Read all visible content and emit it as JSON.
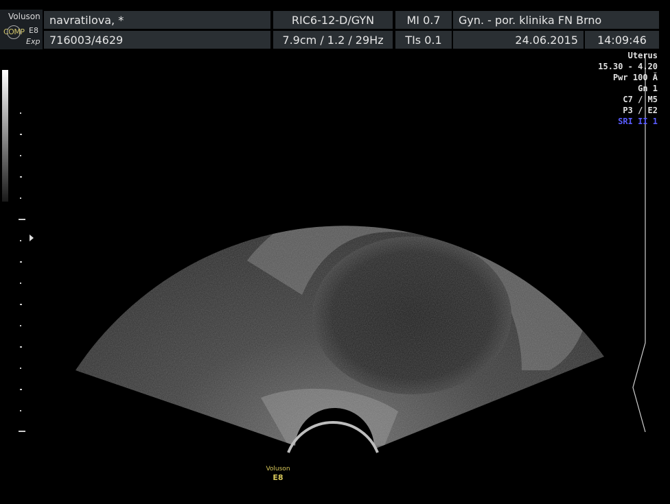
{
  "header": {
    "brand": "Voluson",
    "model": "E8",
    "comp_label": "COMP",
    "exp_label": "Exp",
    "patient_name": "navratilova,  *",
    "patient_id": "716003/4629",
    "probe": "RIC6-12-D/GYN",
    "depth_freq": "7.9cm / 1.2 / 29Hz",
    "mi": "MI  0.7",
    "tis": "TIs  0.1",
    "institution": "Gyn. - por. klinika FN Brno",
    "date": "24.06.2015",
    "time": "14:09:46"
  },
  "params": {
    "preset": "Uterus",
    "range": "15.30 - 4.20",
    "power": "Pwr 100 Ă",
    "gain": "Gn  1",
    "cm": "C7 / M5",
    "pe": "P3 / E2",
    "sri": "SRI II 1"
  },
  "footer": {
    "brand": "Voluson",
    "model": "E8"
  },
  "colors": {
    "header_bg": "#2a2f33",
    "sri_text": "#5a5cff",
    "logo_text": "#d8c85a"
  }
}
